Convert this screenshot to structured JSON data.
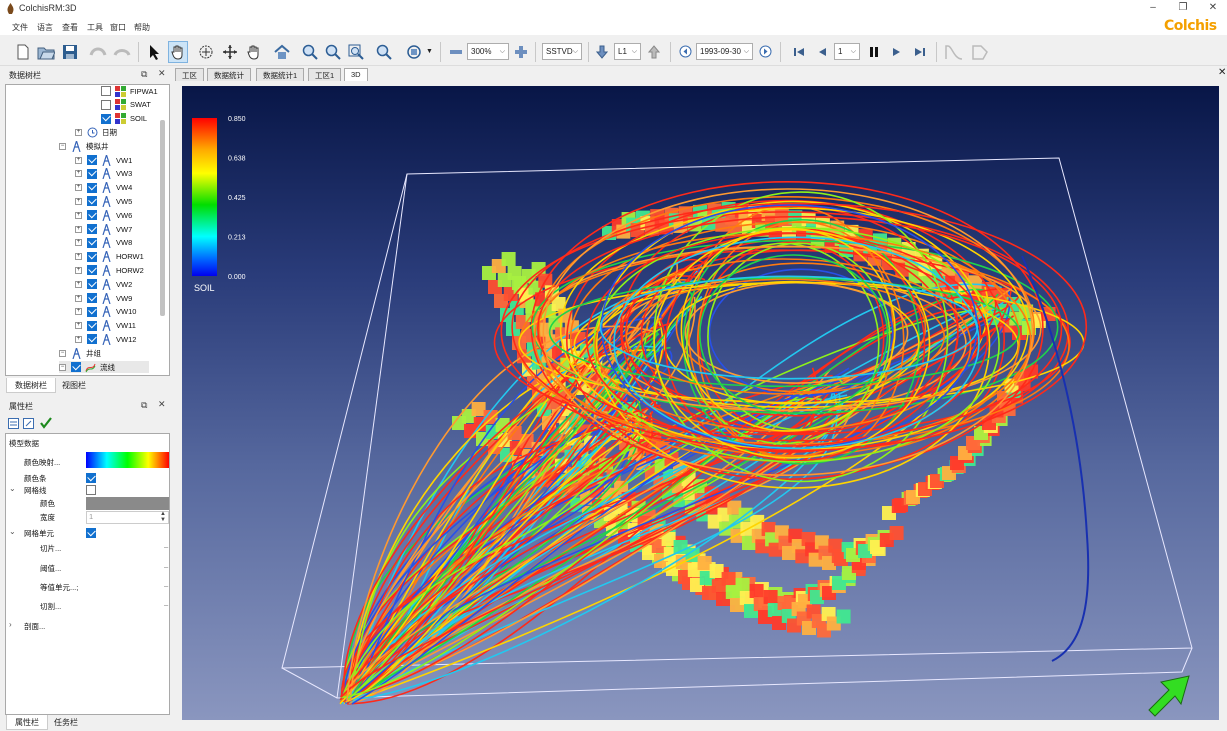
{
  "window": {
    "title": "ColchisRM:3D",
    "brand": "Colchis",
    "controls": [
      "–",
      "❐",
      "✕"
    ]
  },
  "menu": [
    "文件",
    "语言",
    "查看",
    "工具",
    "窗口",
    "帮助"
  ],
  "toolbar": {
    "zoom_value": "300%",
    "depth_mode": "SSTVD",
    "layer": "L1",
    "date": "1993-09-30",
    "step": "1"
  },
  "tree_panel": {
    "title": "数据树栏",
    "items": [
      {
        "label": "FIPWA1",
        "level": 3,
        "checked": false
      },
      {
        "label": "SWAT",
        "level": 3,
        "checked": false
      },
      {
        "label": "SOIL",
        "level": 3,
        "checked": true
      },
      {
        "label": "日期",
        "level": 2
      },
      {
        "label": "模拟井",
        "level": 1
      },
      {
        "label": "VW1",
        "level": 2,
        "checked": true
      },
      {
        "label": "VW3",
        "level": 2,
        "checked": true
      },
      {
        "label": "VW4",
        "level": 2,
        "checked": true
      },
      {
        "label": "VW5",
        "level": 2,
        "checked": true
      },
      {
        "label": "VW6",
        "level": 2,
        "checked": true
      },
      {
        "label": "VW7",
        "level": 2,
        "checked": true
      },
      {
        "label": "VW8",
        "level": 2,
        "checked": true
      },
      {
        "label": "HORW1",
        "level": 2,
        "checked": true
      },
      {
        "label": "HORW2",
        "level": 2,
        "checked": true
      },
      {
        "label": "VW2",
        "level": 2,
        "checked": true
      },
      {
        "label": "VW9",
        "level": 2,
        "checked": true
      },
      {
        "label": "VW10",
        "level": 2,
        "checked": true
      },
      {
        "label": "VW11",
        "level": 2,
        "checked": true
      },
      {
        "label": "VW12",
        "level": 2,
        "checked": true
      },
      {
        "label": "井组",
        "level": 1
      },
      {
        "label": "流线",
        "level": 1,
        "checked": true
      }
    ],
    "tabs": [
      "数据树栏",
      "视图栏"
    ]
  },
  "prop_panel": {
    "title": "属性栏",
    "section": "模型数据",
    "rows": [
      {
        "label": "颜色映射...",
        "kind": "colormap"
      },
      {
        "label": "颜色条",
        "kind": "check",
        "checked": true
      },
      {
        "label": "网格线",
        "kind": "check",
        "checked": false,
        "expand": "v"
      },
      {
        "label": "颜色",
        "kind": "gray"
      },
      {
        "label": "宽度",
        "kind": "spin",
        "value": "1"
      },
      {
        "label": "网格单元",
        "kind": "check",
        "checked": true,
        "expand": "v"
      },
      {
        "label": "切片...",
        "kind": "dash"
      },
      {
        "label": "阈值...",
        "kind": "dash"
      },
      {
        "label": "等值单元...;",
        "kind": "dash"
      },
      {
        "label": "切割...",
        "kind": "dash"
      },
      {
        "label": "剖面...",
        "kind": "none",
        "expand": ">"
      }
    ],
    "tabs": [
      "属性栏",
      "任务栏"
    ]
  },
  "doc_tabs": [
    "工区",
    "数据统计",
    "数据统计1",
    "工区1",
    "3D"
  ],
  "viewport": {
    "colorbar": {
      "title": "SOIL",
      "ticks": [
        "0.850",
        "0.638",
        "0.425",
        "0.213",
        "0.000"
      ]
    }
  },
  "colors": {
    "accent": "#1170cf",
    "brand": "#f4a000",
    "viewport_top": "#081647",
    "viewport_bottom": "#8a96bf"
  }
}
